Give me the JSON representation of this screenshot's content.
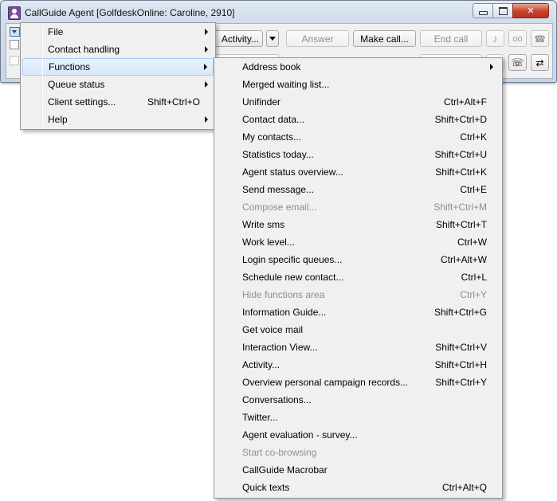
{
  "window": {
    "title": "CallGuide Agent [GolfdeskOnline: Caroline, 2910]"
  },
  "toolbar": {
    "activity_label": "Activity...",
    "answer_label": "Answer",
    "make_call_label": "Make call...",
    "end_call_label": "End call"
  },
  "main_menu": {
    "items": [
      {
        "label": "File",
        "submenu": true
      },
      {
        "label": "Contact handling",
        "submenu": true
      },
      {
        "label": "Functions",
        "submenu": true,
        "highlighted": true
      },
      {
        "label": "Queue status",
        "submenu": true
      },
      {
        "label": "Client settings...",
        "shortcut": "Shift+Ctrl+O"
      },
      {
        "label": "Help",
        "submenu": true
      }
    ]
  },
  "functions_menu": {
    "items": [
      {
        "label": "Address book",
        "submenu": true
      },
      {
        "label": "Merged waiting list..."
      },
      {
        "label": "Unifinder",
        "shortcut": "Ctrl+Alt+F"
      },
      {
        "label": "Contact data...",
        "shortcut": "Shift+Ctrl+D"
      },
      {
        "label": "My contacts...",
        "shortcut": "Ctrl+K"
      },
      {
        "label": "Statistics today...",
        "shortcut": "Shift+Ctrl+U"
      },
      {
        "label": "Agent status overview...",
        "shortcut": "Shift+Ctrl+K"
      },
      {
        "label": "Send message...",
        "shortcut": "Ctrl+E"
      },
      {
        "label": "Compose email...",
        "shortcut": "Shift+Ctrl+M",
        "disabled": true
      },
      {
        "label": "Write sms",
        "shortcut": "Shift+Ctrl+T"
      },
      {
        "label": "Work level...",
        "shortcut": "Ctrl+W"
      },
      {
        "label": "Login specific queues...",
        "shortcut": "Ctrl+Alt+W"
      },
      {
        "label": "Schedule new contact...",
        "shortcut": "Ctrl+L"
      },
      {
        "label": "Hide functions area",
        "shortcut": "Ctrl+Y",
        "disabled": true
      },
      {
        "label": "Information Guide...",
        "shortcut": "Shift+Ctrl+G"
      },
      {
        "label": "Get voice mail"
      },
      {
        "label": "Interaction View...",
        "shortcut": "Shift+Ctrl+V"
      },
      {
        "label": "Activity...",
        "shortcut": "Shift+Ctrl+H"
      },
      {
        "label": "Overview personal campaign records...",
        "shortcut": "Shift+Ctrl+Y"
      },
      {
        "label": "Conversations..."
      },
      {
        "label": "Twitter..."
      },
      {
        "label": "Agent evaluation - survey..."
      },
      {
        "label": "Start co-browsing",
        "disabled": true
      },
      {
        "label": "CallGuide Macrobar"
      },
      {
        "label": "Quick texts",
        "shortcut": "Ctrl+Alt+Q"
      }
    ]
  }
}
